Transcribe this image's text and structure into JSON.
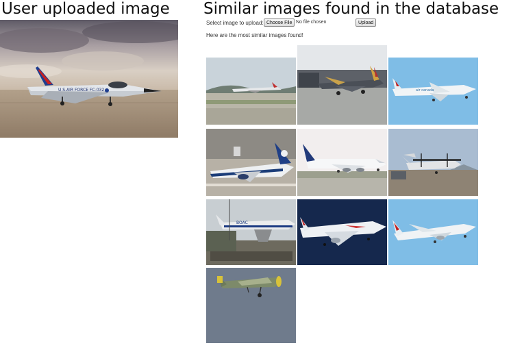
{
  "left_panel": {
    "heading": "User uploaded image",
    "image_icon": "fighter-jet-photo-icon"
  },
  "right_panel": {
    "heading": "Similar images found in the database",
    "upload_form": {
      "label": "Select image to upload:",
      "choose_button": "Choose File",
      "file_status": "No file chosen",
      "upload_button": "Upload"
    },
    "results_message": "Here are the most similar images found!",
    "results": [
      {
        "icon": "airliner-landing-photo-icon"
      },
      {
        "icon": "fighter-jet-photo-icon"
      },
      {
        "icon": "regional-jet-photo-icon"
      },
      {
        "icon": "airliner-ground-photo-icon"
      },
      {
        "icon": "jumbo-jet-photo-icon"
      },
      {
        "icon": "turboprop-photo-icon"
      },
      {
        "icon": "vintage-airliner-photo-icon"
      },
      {
        "icon": "airliner-night-photo-icon"
      },
      {
        "icon": "regional-jet-photo-icon"
      },
      {
        "icon": "warbird-photo-icon"
      }
    ]
  }
}
